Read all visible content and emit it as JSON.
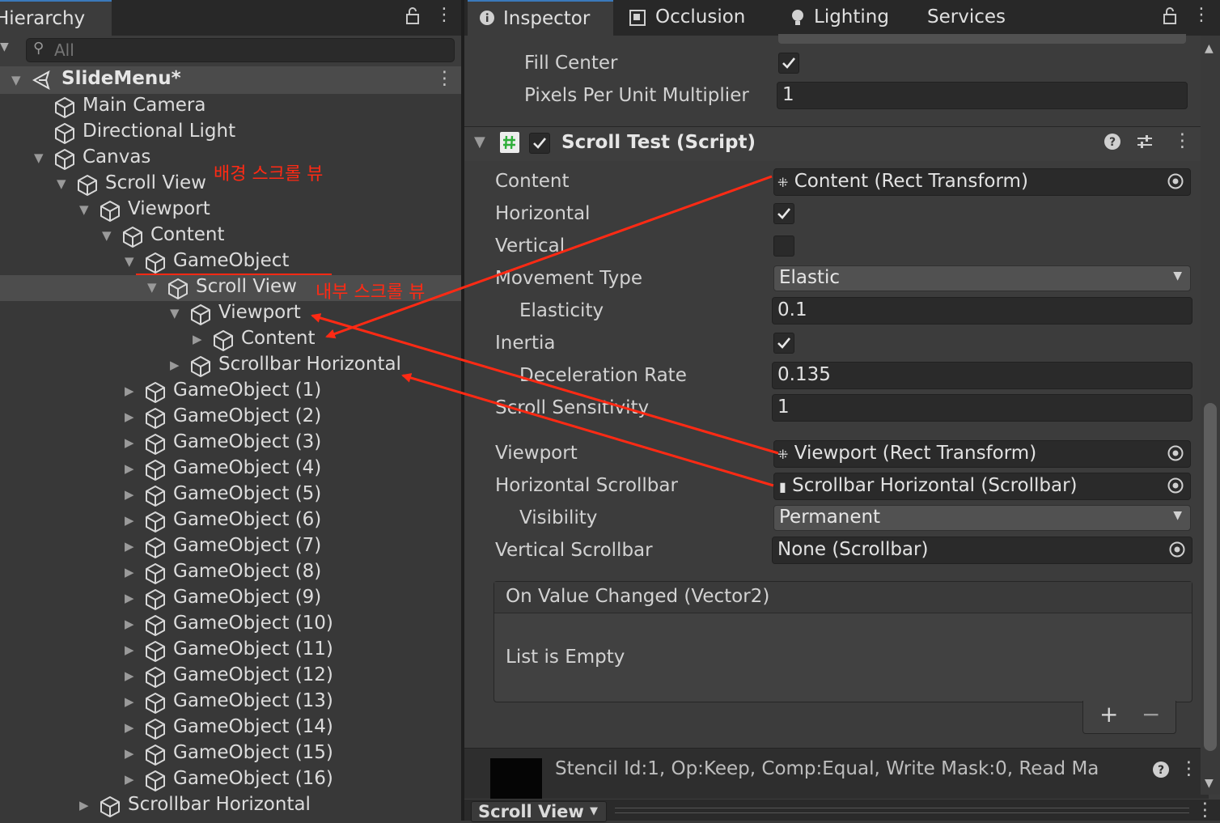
{
  "hierarchy": {
    "tab_label": "Hierarchy",
    "search_placeholder": "All",
    "scene_name": "SlideMenu*",
    "rows": [
      {
        "label": "Main Camera"
      },
      {
        "label": "Directional Light"
      },
      {
        "label": "Canvas"
      },
      {
        "label": "Scroll View"
      },
      {
        "label": "Viewport"
      },
      {
        "label": "Content"
      },
      {
        "label": "GameObject"
      },
      {
        "label": "Scroll View"
      },
      {
        "label": "Viewport"
      },
      {
        "label": "Content"
      },
      {
        "label": "Scrollbar Horizontal"
      },
      {
        "label": "GameObject (1)"
      },
      {
        "label": "GameObject (2)"
      },
      {
        "label": "GameObject (3)"
      },
      {
        "label": "GameObject (4)"
      },
      {
        "label": "GameObject (5)"
      },
      {
        "label": "GameObject (6)"
      },
      {
        "label": "GameObject (7)"
      },
      {
        "label": "GameObject (8)"
      },
      {
        "label": "GameObject (9)"
      },
      {
        "label": "GameObject (10)"
      },
      {
        "label": "GameObject (11)"
      },
      {
        "label": "GameObject (12)"
      },
      {
        "label": "GameObject (13)"
      },
      {
        "label": "GameObject (14)"
      },
      {
        "label": "GameObject (15)"
      },
      {
        "label": "GameObject (16)"
      },
      {
        "label": "Scrollbar Horizontal"
      }
    ],
    "annotations": {
      "outer_scroll_view": "배경 스크롤 뷰",
      "inner_scroll_view": "내부 스크롤 뷰"
    }
  },
  "inspector": {
    "tabs": [
      "Inspector",
      "Occlusion",
      "Lighting",
      "Services"
    ],
    "image_section": {
      "fill_center_label": "Fill Center",
      "fill_center_checked": true,
      "ppu_label": "Pixels Per Unit Multiplier",
      "ppu_value": "1"
    },
    "component": {
      "title": "Scroll Test (Script)",
      "enabled": true,
      "content_label": "Content",
      "content_value": "Content (Rect Transform)",
      "horizontal_label": "Horizontal",
      "horizontal_checked": true,
      "vertical_label": "Vertical",
      "vertical_checked": false,
      "movement_type_label": "Movement Type",
      "movement_type_value": "Elastic",
      "elasticity_label": "Elasticity",
      "elasticity_value": "0.1",
      "inertia_label": "Inertia",
      "inertia_checked": true,
      "deceleration_label": "Deceleration Rate",
      "deceleration_value": "0.135",
      "sensitivity_label": "Scroll Sensitivity",
      "sensitivity_value": "1",
      "viewport_label": "Viewport",
      "viewport_value": "Viewport (Rect Transform)",
      "hscroll_label": "Horizontal Scrollbar",
      "hscroll_value": "Scrollbar Horizontal (Scrollbar)",
      "visibility_label": "Visibility",
      "visibility_value": "Permanent",
      "vscroll_label": "Vertical Scrollbar",
      "vscroll_value": "None (Scrollbar)",
      "event_title": "On Value Changed (Vector2)",
      "event_empty": "List is Empty",
      "plus": "+",
      "minus": "−"
    },
    "stencil_text": "Stencil Id:1, Op:Keep, Comp:Equal, Write Mask:0, Read Ma",
    "bottom_label": "Scroll View"
  },
  "colors": {
    "annotation": "#ff2a14",
    "tab_accent": "#3a79bb",
    "script_icon": "#3fbf3f"
  }
}
